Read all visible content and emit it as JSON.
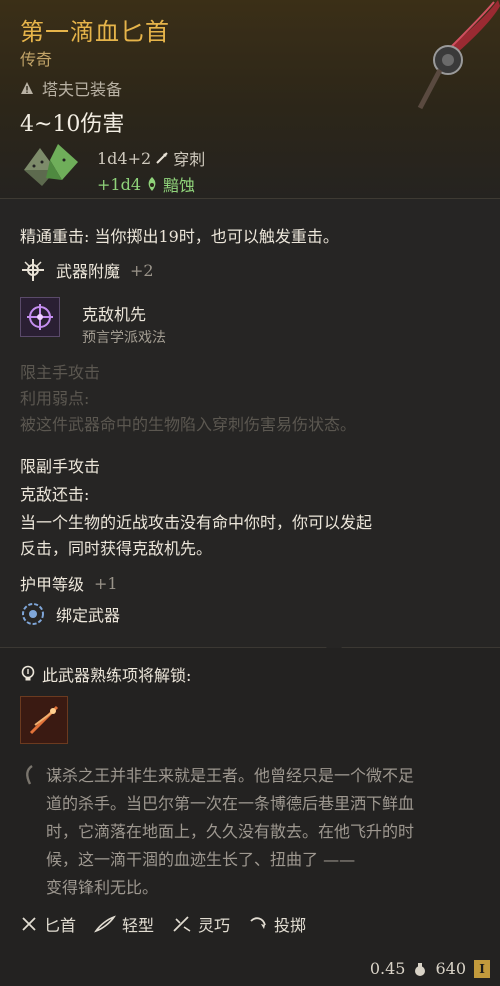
{
  "item": {
    "name": "第一滴血匕首",
    "rarity": "传奇",
    "equipped_by": "塔夫已装备",
    "damage_range": "4~10伤害",
    "damage_primary": "1d4+2",
    "damage_primary_type": "穿刺",
    "damage_secondary": "+1d4",
    "damage_secondary_type": "黯蚀"
  },
  "properties": {
    "master_crit": "精通重击: 当你掷出19时，也可以触发重击。",
    "enchant_label": "武器附魔",
    "enchant_value": "+2",
    "spell_name": "克敌机先",
    "spell_school": "预言学派戏法",
    "main_hand_title": "限主手攻击",
    "main_hand_sub": "利用弱点:",
    "main_hand_desc": "被这件武器命中的生物陷入穿刺伤害易伤状态。",
    "off_hand_title": "限副手攻击",
    "off_hand_sub": "克敌还击:",
    "off_hand_desc_1": "当一个生物的近战攻击没有命中你时，你可以发起",
    "off_hand_desc_2": "反击，同时获得克敌机先。",
    "armor_label": "护甲等级",
    "armor_value": "+1",
    "bound_label": "绑定武器"
  },
  "mastery": {
    "unlock_text": "此武器熟练项将解锁:"
  },
  "lore": [
    "谋杀之王并非生来就是王者。他曾经只是一个微不足",
    "道的杀手。当巴尔第一次在一条博德后巷里洒下鲜血",
    "时，它滴落在地面上，久久没有散去。在他飞升的时",
    "候，这一滴干涸的血迹生长了、扭曲了 ——",
    "变得锋利无比。"
  ],
  "tags": [
    "匕首",
    "轻型",
    "灵巧",
    "投掷"
  ],
  "stats": {
    "weight": "0.45",
    "value": "640"
  },
  "colors": {
    "title_gold": "#e6b44a",
    "green_bonus": "#8fd37a",
    "disabled_text": "#5b5750"
  }
}
